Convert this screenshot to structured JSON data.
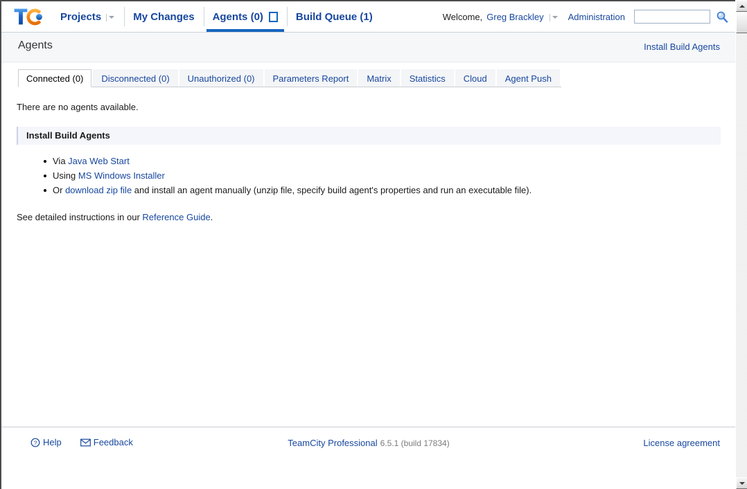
{
  "header": {
    "logo_alt": "teamcity-logo",
    "nav": [
      {
        "label": "Projects",
        "has_caret": true,
        "active": false
      },
      {
        "label": "My Changes",
        "has_caret": false,
        "active": false
      },
      {
        "label": "Agents (0)",
        "has_caret": false,
        "active": true,
        "badge_box": true
      },
      {
        "label": "Build Queue (1)",
        "has_caret": false,
        "active": false
      }
    ],
    "welcome_label": "Welcome,",
    "user_name": "Greg Brackley",
    "administration_label": "Administration",
    "search_value": "",
    "search_placeholder": "",
    "search_icon": "search-icon"
  },
  "page": {
    "title": "Agents",
    "header_action_link": "Install Build Agents"
  },
  "tabs": [
    {
      "label": "Connected (0)",
      "active": true
    },
    {
      "label": "Disconnected (0)",
      "active": false
    },
    {
      "label": "Unauthorized (0)",
      "active": false
    },
    {
      "label": "Parameters Report",
      "active": false
    },
    {
      "label": "Matrix",
      "active": false
    },
    {
      "label": "Statistics",
      "active": false
    },
    {
      "label": "Cloud",
      "active": false
    },
    {
      "label": "Agent Push",
      "active": false
    }
  ],
  "main": {
    "empty_message": "There are no agents available.",
    "panel_title": "Install Build Agents",
    "items": [
      {
        "prefix": "Via ",
        "link": "Java Web Start",
        "suffix": ""
      },
      {
        "prefix": "Using ",
        "link": "MS Windows Installer",
        "suffix": ""
      },
      {
        "prefix": "Or ",
        "link": "download zip file",
        "suffix": " and install an agent manually (unzip file, specify build agent's properties and run an executable file)."
      }
    ],
    "reference_prefix": "See detailed instructions in our ",
    "reference_link": "Reference Guide",
    "reference_suffix": "."
  },
  "footer": {
    "help_label": "Help",
    "help_icon": "question-circle-icon",
    "feedback_label": "Feedback",
    "feedback_icon": "envelope-icon",
    "product_name": "TeamCity Professional",
    "version": "6.5.1 (build 17834)",
    "license_label": "License agreement"
  },
  "colors": {
    "link": "#17479e",
    "accent": "#1565c0",
    "panel_header_bg": "#f5f6fb",
    "title_strip_bg": "#f6f7f9"
  },
  "scrollbar": {
    "up_icon": "scroll-up-icon",
    "down_icon": "scroll-down-icon"
  }
}
